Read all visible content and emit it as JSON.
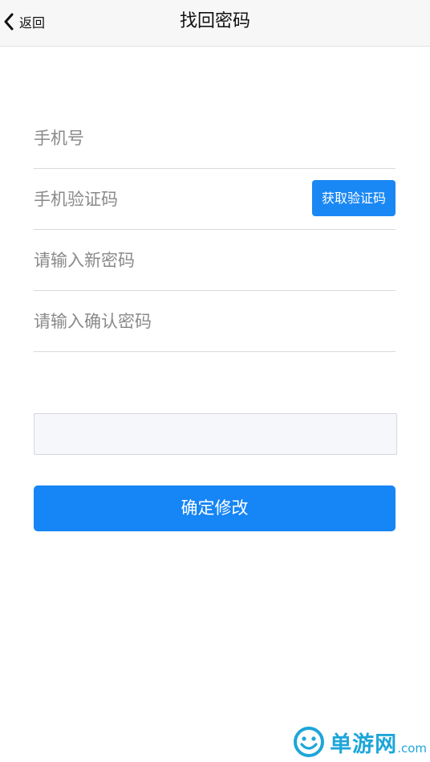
{
  "header": {
    "back_label": "返回",
    "title": "找回密码"
  },
  "form": {
    "phone_placeholder": "手机号",
    "code_placeholder": "手机验证码",
    "get_code_label": "获取验证码",
    "new_password_placeholder": "请输入新密码",
    "confirm_password_placeholder": "请输入确认密码",
    "submit_label": "确定修改"
  },
  "watermark": {
    "text": "单游网",
    "suffix": ".com"
  },
  "colors": {
    "accent": "#1685f5",
    "nav_bg": "#f7f7f7",
    "watermark": "#1ea6d9"
  }
}
